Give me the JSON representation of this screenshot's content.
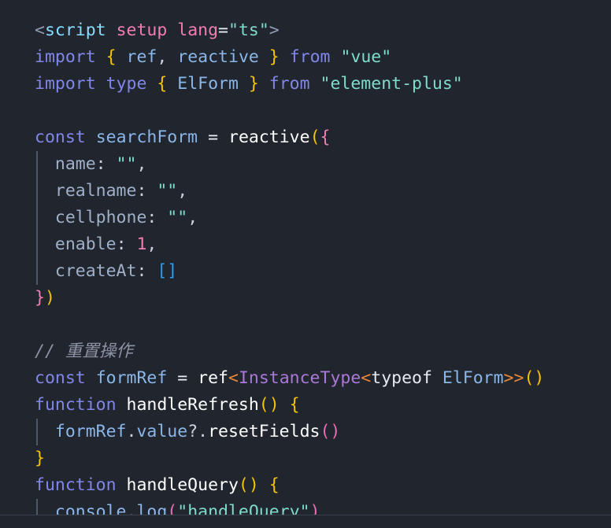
{
  "editor": {
    "language": "TypeScript / Vue SFC",
    "background_color": "#21252e",
    "indent_guide_color": "#4b5869",
    "font_size_px": 21.5,
    "line_height_px": 34
  },
  "code": {
    "raw_text": "<script setup lang=\"ts\">\nimport { ref, reactive } from \"vue\"\nimport type { ElForm } from \"element-plus\"\n\nconst searchForm = reactive({\n  name: \"\",\n  realname: \"\",\n  cellphone: \"\",\n  enable: 1,\n  createAt: []\n})\n\n// 重置操作\nconst formRef = ref<InstanceType<typeof ElForm>>()\nfunction handleRefresh() {\n  formRef.value?.resetFields()\n}\nfunction handleQuery() {\n  console.log(\"handleQuery\")",
    "lines": [
      {
        "id": "line-1",
        "indent_guide": false,
        "tokens": [
          {
            "text": "<",
            "cls": "t-tagbracket"
          },
          {
            "text": "script",
            "cls": "t-tag"
          },
          {
            "text": " ",
            "cls": "t-plain"
          },
          {
            "text": "setup",
            "cls": "t-attr"
          },
          {
            "text": " ",
            "cls": "t-plain"
          },
          {
            "text": "lang",
            "cls": "t-attr"
          },
          {
            "text": "=",
            "cls": "t-op"
          },
          {
            "text": "\"ts\"",
            "cls": "t-string"
          },
          {
            "text": ">",
            "cls": "t-tagbracket"
          }
        ]
      },
      {
        "id": "line-2",
        "indent_guide": false,
        "tokens": [
          {
            "text": "import",
            "cls": "t-keyword"
          },
          {
            "text": " ",
            "cls": "t-plain"
          },
          {
            "text": "{",
            "cls": "t-brace-y"
          },
          {
            "text": " ",
            "cls": "t-plain"
          },
          {
            "text": "ref",
            "cls": "t-var"
          },
          {
            "text": ",",
            "cls": "t-punct"
          },
          {
            "text": " ",
            "cls": "t-plain"
          },
          {
            "text": "reactive",
            "cls": "t-var"
          },
          {
            "text": " ",
            "cls": "t-plain"
          },
          {
            "text": "}",
            "cls": "t-brace-y"
          },
          {
            "text": " ",
            "cls": "t-plain"
          },
          {
            "text": "from",
            "cls": "t-keyword"
          },
          {
            "text": " ",
            "cls": "t-plain"
          },
          {
            "text": "\"vue\"",
            "cls": "t-string"
          }
        ]
      },
      {
        "id": "line-3",
        "indent_guide": false,
        "tokens": [
          {
            "text": "import",
            "cls": "t-keyword"
          },
          {
            "text": " ",
            "cls": "t-plain"
          },
          {
            "text": "type",
            "cls": "t-keyword"
          },
          {
            "text": " ",
            "cls": "t-plain"
          },
          {
            "text": "{",
            "cls": "t-brace-y"
          },
          {
            "text": " ",
            "cls": "t-plain"
          },
          {
            "text": "ElForm",
            "cls": "t-var"
          },
          {
            "text": " ",
            "cls": "t-plain"
          },
          {
            "text": "}",
            "cls": "t-brace-y"
          },
          {
            "text": " ",
            "cls": "t-plain"
          },
          {
            "text": "from",
            "cls": "t-keyword"
          },
          {
            "text": " ",
            "cls": "t-plain"
          },
          {
            "text": "\"element-plus\"",
            "cls": "t-string"
          }
        ]
      },
      {
        "id": "line-4",
        "indent_guide": false,
        "tokens": []
      },
      {
        "id": "line-5",
        "indent_guide": false,
        "tokens": [
          {
            "text": "const",
            "cls": "t-keyword"
          },
          {
            "text": " ",
            "cls": "t-plain"
          },
          {
            "text": "searchForm",
            "cls": "t-var"
          },
          {
            "text": " ",
            "cls": "t-plain"
          },
          {
            "text": "=",
            "cls": "t-op"
          },
          {
            "text": " ",
            "cls": "t-plain"
          },
          {
            "text": "reactive",
            "cls": "t-func"
          },
          {
            "text": "(",
            "cls": "t-brace-y"
          },
          {
            "text": "{",
            "cls": "t-brace-p"
          }
        ]
      },
      {
        "id": "line-6",
        "indent_guide": true,
        "tokens": [
          {
            "text": "  ",
            "cls": "t-plain"
          },
          {
            "text": "name",
            "cls": "t-prop"
          },
          {
            "text": ":",
            "cls": "t-punct"
          },
          {
            "text": " ",
            "cls": "t-plain"
          },
          {
            "text": "\"\"",
            "cls": "t-string"
          },
          {
            "text": ",",
            "cls": "t-punct"
          }
        ]
      },
      {
        "id": "line-7",
        "indent_guide": true,
        "tokens": [
          {
            "text": "  ",
            "cls": "t-plain"
          },
          {
            "text": "realname",
            "cls": "t-prop"
          },
          {
            "text": ":",
            "cls": "t-punct"
          },
          {
            "text": " ",
            "cls": "t-plain"
          },
          {
            "text": "\"\"",
            "cls": "t-string"
          },
          {
            "text": ",",
            "cls": "t-punct"
          }
        ]
      },
      {
        "id": "line-8",
        "indent_guide": true,
        "tokens": [
          {
            "text": "  ",
            "cls": "t-plain"
          },
          {
            "text": "cellphone",
            "cls": "t-prop"
          },
          {
            "text": ":",
            "cls": "t-punct"
          },
          {
            "text": " ",
            "cls": "t-plain"
          },
          {
            "text": "\"\"",
            "cls": "t-string"
          },
          {
            "text": ",",
            "cls": "t-punct"
          }
        ]
      },
      {
        "id": "line-9",
        "indent_guide": true,
        "tokens": [
          {
            "text": "  ",
            "cls": "t-plain"
          },
          {
            "text": "enable",
            "cls": "t-prop"
          },
          {
            "text": ":",
            "cls": "t-punct"
          },
          {
            "text": " ",
            "cls": "t-plain"
          },
          {
            "text": "1",
            "cls": "t-number"
          },
          {
            "text": ",",
            "cls": "t-punct"
          }
        ]
      },
      {
        "id": "line-10",
        "indent_guide": true,
        "tokens": [
          {
            "text": "  ",
            "cls": "t-plain"
          },
          {
            "text": "createAt",
            "cls": "t-prop"
          },
          {
            "text": ":",
            "cls": "t-punct"
          },
          {
            "text": " ",
            "cls": "t-plain"
          },
          {
            "text": "[]",
            "cls": "t-brace-b"
          }
        ]
      },
      {
        "id": "line-11",
        "indent_guide": false,
        "tokens": [
          {
            "text": "}",
            "cls": "t-brace-p"
          },
          {
            "text": ")",
            "cls": "t-brace-y"
          }
        ]
      },
      {
        "id": "line-12",
        "indent_guide": false,
        "tokens": []
      },
      {
        "id": "line-13",
        "indent_guide": false,
        "tokens": [
          {
            "text": "// 重置操作",
            "cls": "t-comment"
          }
        ]
      },
      {
        "id": "line-14",
        "indent_guide": false,
        "tokens": [
          {
            "text": "const",
            "cls": "t-keyword"
          },
          {
            "text": " ",
            "cls": "t-plain"
          },
          {
            "text": "formRef",
            "cls": "t-var"
          },
          {
            "text": " ",
            "cls": "t-plain"
          },
          {
            "text": "=",
            "cls": "t-op"
          },
          {
            "text": " ",
            "cls": "t-plain"
          },
          {
            "text": "ref",
            "cls": "t-func"
          },
          {
            "text": "<",
            "cls": "t-angle"
          },
          {
            "text": "InstanceType",
            "cls": "t-type"
          },
          {
            "text": "<",
            "cls": "t-angle"
          },
          {
            "text": "typeof",
            "cls": "t-plain"
          },
          {
            "text": " ",
            "cls": "t-plain"
          },
          {
            "text": "ElForm",
            "cls": "t-var"
          },
          {
            "text": ">>",
            "cls": "t-angle"
          },
          {
            "text": "()",
            "cls": "t-brace-y"
          }
        ]
      },
      {
        "id": "line-15",
        "indent_guide": false,
        "tokens": [
          {
            "text": "function",
            "cls": "t-keyword"
          },
          {
            "text": " ",
            "cls": "t-plain"
          },
          {
            "text": "handleRefresh",
            "cls": "t-func"
          },
          {
            "text": "()",
            "cls": "t-brace-y"
          },
          {
            "text": " ",
            "cls": "t-plain"
          },
          {
            "text": "{",
            "cls": "t-brace-y"
          }
        ]
      },
      {
        "id": "line-16",
        "indent_guide": true,
        "tokens": [
          {
            "text": "  ",
            "cls": "t-plain"
          },
          {
            "text": "formRef",
            "cls": "t-var"
          },
          {
            "text": ".",
            "cls": "t-punct"
          },
          {
            "text": "value",
            "cls": "t-var"
          },
          {
            "text": "?.",
            "cls": "t-punct"
          },
          {
            "text": "resetFields",
            "cls": "t-func"
          },
          {
            "text": "()",
            "cls": "t-paren-p"
          }
        ]
      },
      {
        "id": "line-17",
        "indent_guide": false,
        "tokens": [
          {
            "text": "}",
            "cls": "t-brace-y"
          }
        ]
      },
      {
        "id": "line-18",
        "indent_guide": false,
        "tokens": [
          {
            "text": "function",
            "cls": "t-keyword"
          },
          {
            "text": " ",
            "cls": "t-plain"
          },
          {
            "text": "handleQuery",
            "cls": "t-func"
          },
          {
            "text": "()",
            "cls": "t-brace-y"
          },
          {
            "text": " ",
            "cls": "t-plain"
          },
          {
            "text": "{",
            "cls": "t-brace-y"
          }
        ]
      },
      {
        "id": "line-19",
        "indent_guide": true,
        "tokens": [
          {
            "text": "  ",
            "cls": "t-plain"
          },
          {
            "text": "console",
            "cls": "t-var"
          },
          {
            "text": ".",
            "cls": "t-punct"
          },
          {
            "text": "log",
            "cls": "t-var"
          },
          {
            "text": "(",
            "cls": "t-paren-p"
          },
          {
            "text": "\"handleQuery\"",
            "cls": "t-string"
          },
          {
            "text": ")",
            "cls": "t-paren-p"
          }
        ]
      }
    ]
  }
}
